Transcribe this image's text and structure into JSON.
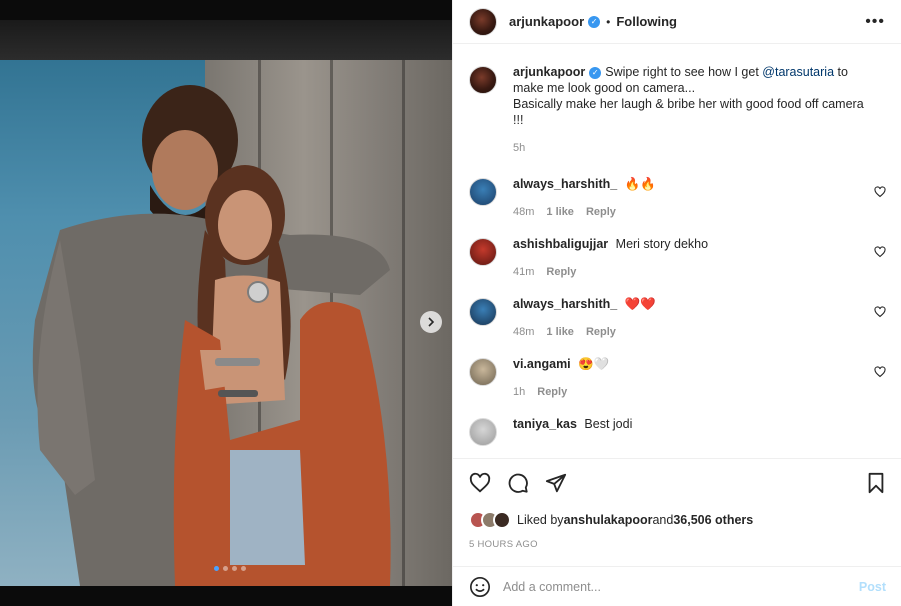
{
  "header": {
    "username": "arjunkapoor",
    "separator": "•",
    "follow_state": "Following",
    "more_icon": "more-horizontal-icon"
  },
  "caption": {
    "username": "arjunkapoor",
    "text_part1": "Swipe right to see how I get ",
    "mention": "@tarasutaria",
    "text_part2": " to make me look good on camera...",
    "text_line2": "Basically make her laugh & bribe her with good food off camera !!!",
    "time": "5h"
  },
  "comments": [
    {
      "username": "always_harshith_",
      "text": "🔥🔥",
      "time": "48m",
      "likes": "1 like",
      "reply": "Reply"
    },
    {
      "username": "ashishbaligujjar",
      "text": "Meri story dekho",
      "time": "41m",
      "likes": "",
      "reply": "Reply"
    },
    {
      "username": "always_harshith_",
      "text": "❤️❤️",
      "time": "48m",
      "likes": "1 like",
      "reply": "Reply"
    },
    {
      "username": "vi.angami",
      "text": "😍🤍",
      "time": "1h",
      "likes": "",
      "reply": "Reply"
    },
    {
      "username": "taniya_kas",
      "text": "Best jodi",
      "time": "",
      "likes": "",
      "reply": ""
    }
  ],
  "likes": {
    "prefix": "Liked by ",
    "liked_by": "anshulakapoor",
    "and": " and ",
    "others": "36,506 others"
  },
  "post_time": "5 HOURS AGO",
  "add_comment": {
    "placeholder": "Add a comment...",
    "post_label": "Post"
  },
  "carousel": {
    "slide_count": 4,
    "active_index": 0
  },
  "colors": {
    "link": "#00376b",
    "verified": "#3897f0",
    "post_disabled": "#b2dffc",
    "muted": "#8e8e8e"
  }
}
